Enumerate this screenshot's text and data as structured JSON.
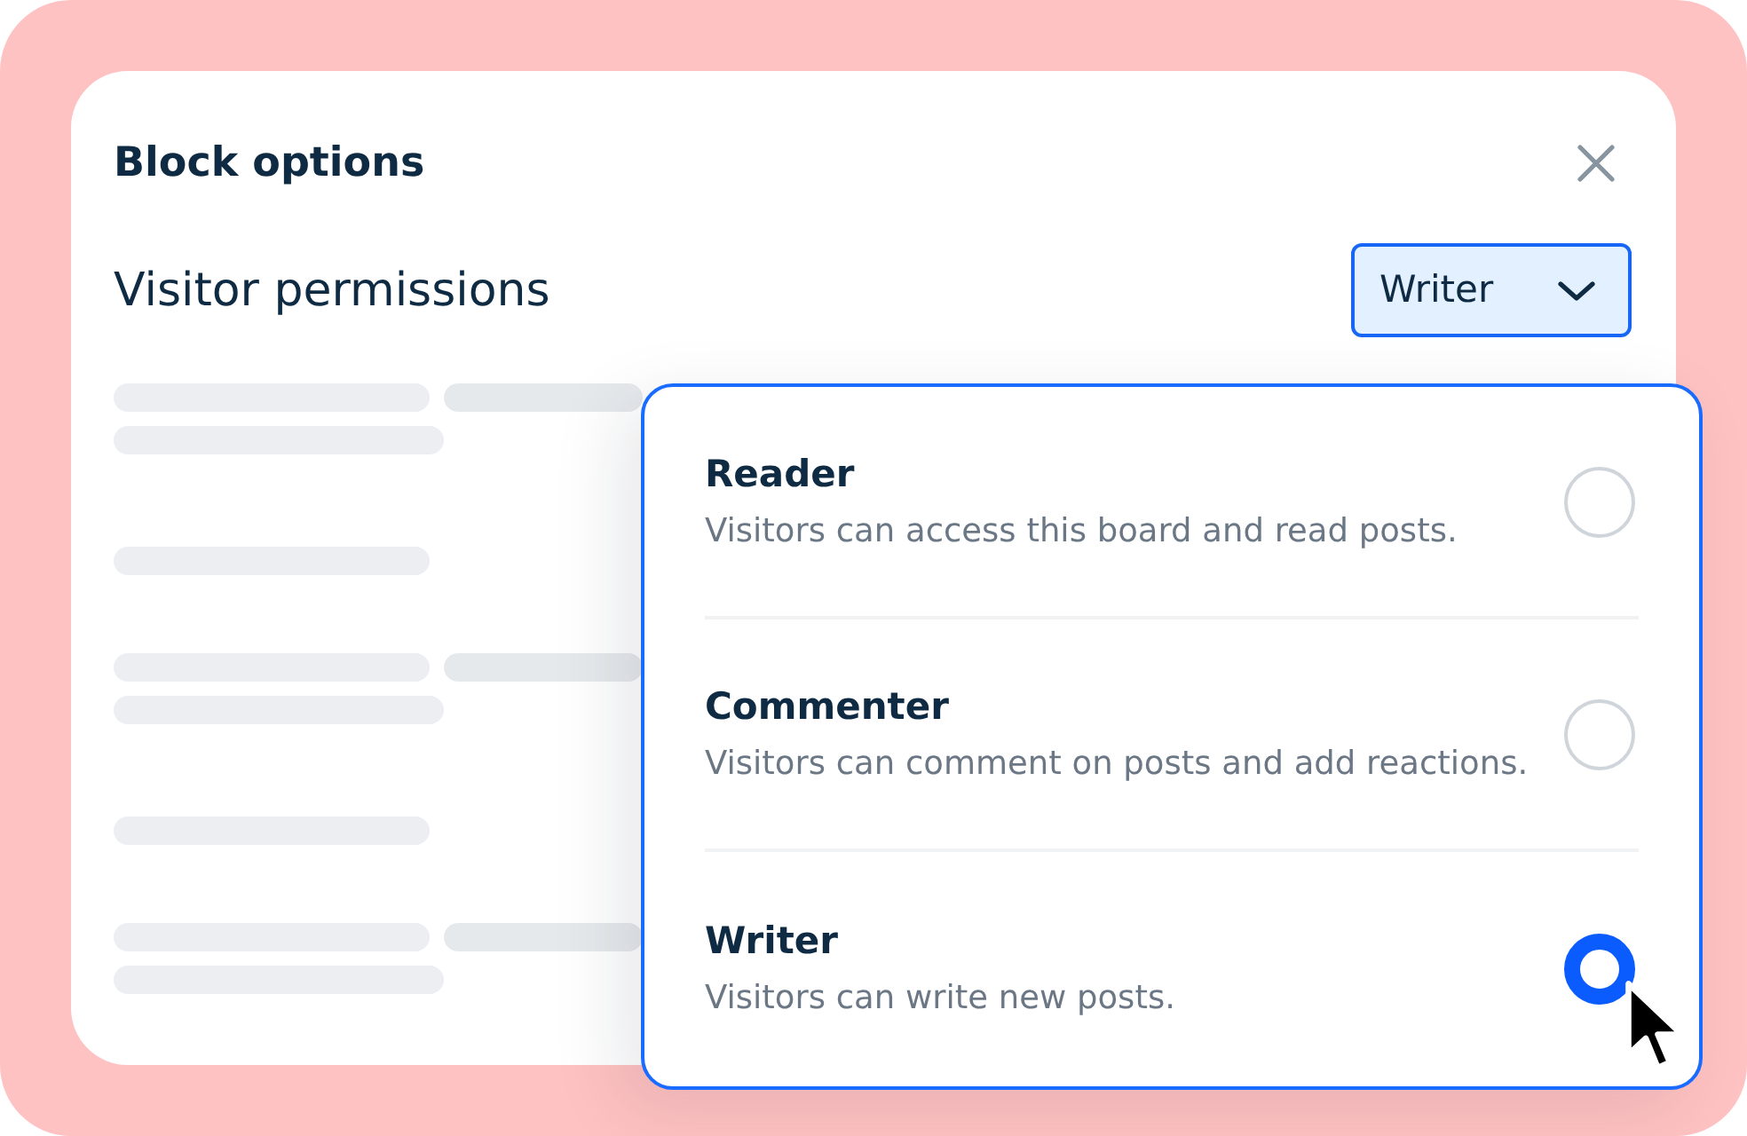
{
  "dialog": {
    "title": "Block options"
  },
  "permission": {
    "label": "Visitor permissions",
    "value": "Writer",
    "expanded": true
  },
  "options": [
    {
      "title": "Reader",
      "description": "Visitors can access this board and read posts.",
      "selected": false
    },
    {
      "title": "Commenter",
      "description": "Visitors can comment on posts and add reactions.",
      "selected": false
    },
    {
      "title": "Writer",
      "description": "Visitors can write new posts.",
      "selected": true
    }
  ]
}
